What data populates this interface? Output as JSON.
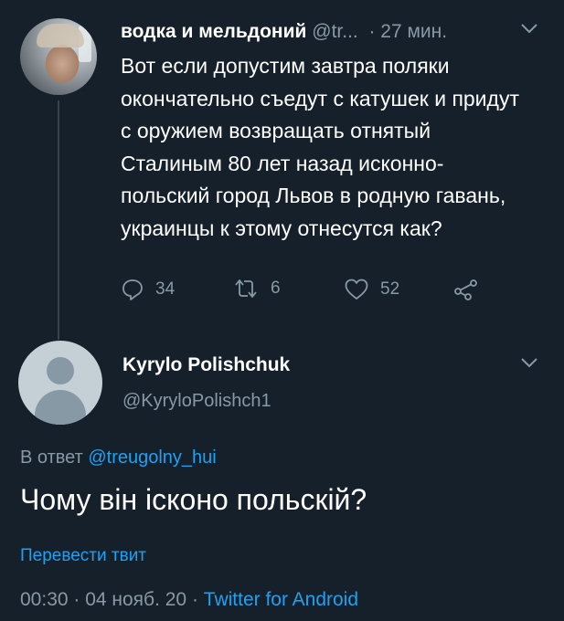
{
  "tweet": {
    "name": "водка и мельдоний",
    "handle": "@tr...",
    "separator": "·",
    "time": "27 мин.",
    "text": "Вот если допустим завтра поляки окончательно съедут с катушек и придут с оружием возвращать отнятый Сталиным 80 лет назад исконно-польский город Львов в родную гавань, украинцы к этому отнесутся как?",
    "replies": "34",
    "retweets": "6",
    "likes": "52"
  },
  "reply": {
    "name": "Kyrylo Polishchuk",
    "handle": "@KyryloPolishch1",
    "replying_prefix": "В ответ",
    "replying_to": "@treugolny_hui",
    "text": "Чому він ісконо польскій?",
    "translate": "Перевести твит",
    "timestamp": "00:30 · 04 нояб. 20 ·",
    "source": "Twitter for Android"
  },
  "colors": {
    "background": "#15202b",
    "muted": "#8899a6",
    "accent": "#1da1f2",
    "text": "#ffffff"
  }
}
